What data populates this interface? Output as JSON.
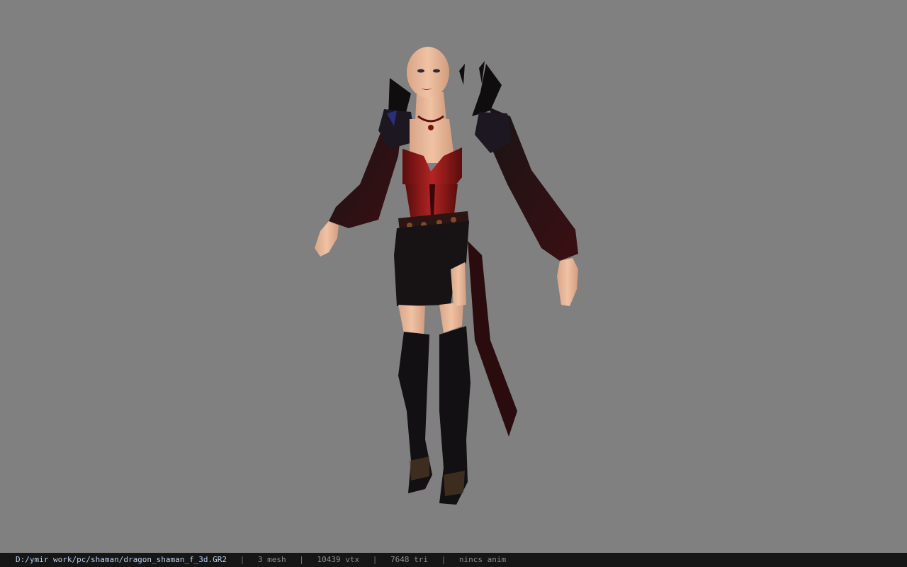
{
  "viewport": {
    "background": "#808080",
    "model_name": "dragon_shaman_f_3d"
  },
  "status": {
    "file_path": "D:/ymir work/pc/shaman/dragon_shaman_f_3d.GR2",
    "separator": "|",
    "mesh": "3 mesh",
    "vertices": "10439 vtx",
    "triangles": "7648 tri",
    "anim": "nincs anim"
  },
  "colors": {
    "statusbar_bg": "#161616",
    "path_text": "#b9d0ef",
    "stat_text": "#8e8e8e",
    "skin": "#e7b898",
    "cloth_black": "#151214",
    "cloth_red": "#8a1a1a"
  }
}
